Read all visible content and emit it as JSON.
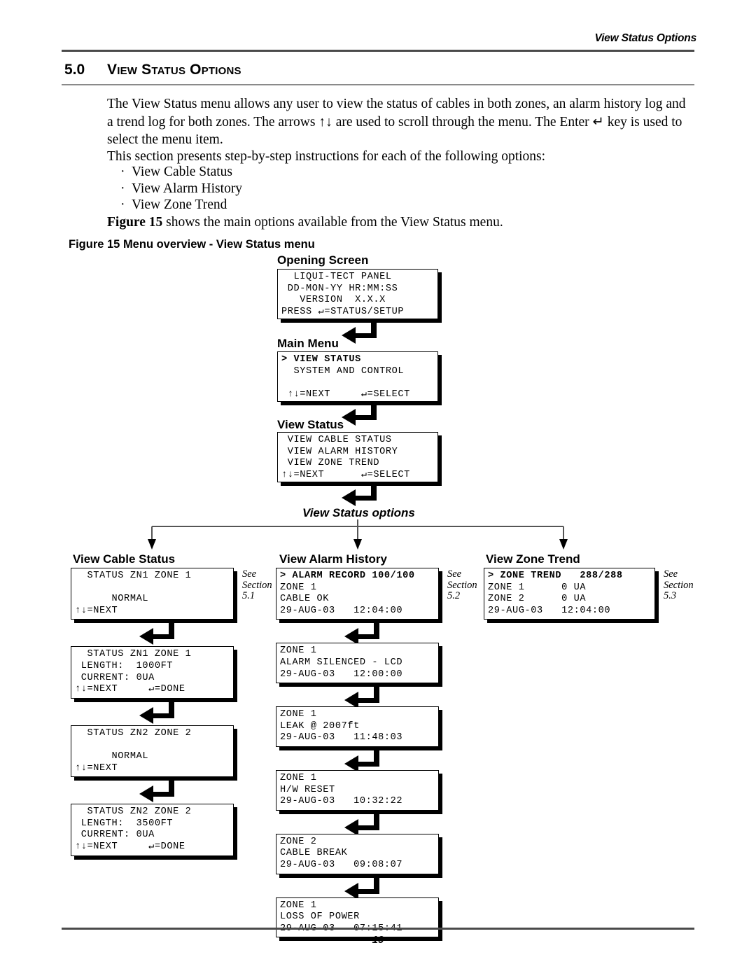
{
  "header": {
    "running_head": "View Status Options",
    "section_number": "5.0",
    "section_title": "View Status Options"
  },
  "body": {
    "paragraph_1": "The View Status menu allows any user to view the status of cables in both zones, an alarm history log and a trend log for both zones. The arrows ↑↓ are used to scroll through the menu. The Enter ↵ key is used to select the menu item.",
    "paragraph_2": "This section presents step-by-step instructions for each of the following options:",
    "bullets": [
      "View Cable Status",
      "View Alarm History",
      "View Zone Trend"
    ],
    "paragraph_3_bold": "Figure 15",
    "paragraph_3_rest": " shows the main options available from the View Status menu.",
    "figure_caption": "Figure 15  Menu overview - View Status menu"
  },
  "diagram": {
    "labels": {
      "opening_screen": "Opening Screen",
      "main_menu": "Main Menu",
      "view_status": "View Status",
      "view_status_options": "View Status options",
      "view_cable_status": "View Cable Status",
      "view_alarm_history": "View Alarm History",
      "view_zone_trend": "View Zone Trend"
    },
    "opening_screen": {
      "rows": [
        "  LIQUI-TECT PANEL",
        " DD-MON-YY HR:MM:SS",
        "   VERSION  X.X.X",
        "PRESS ↵=STATUS/SETUP"
      ]
    },
    "main_menu": {
      "rows": [
        "> VIEW STATUS",
        "  SYSTEM AND CONTROL",
        "",
        " ↑↓=NEXT     ↵=SELECT"
      ],
      "bold_rows": [
        0
      ]
    },
    "view_status": {
      "rows": [
        " VIEW CABLE STATUS",
        " VIEW ALARM HISTORY",
        " VIEW ZONE TREND",
        "↑↓=NEXT      ↵=SELECT"
      ]
    },
    "cable_status_screens": [
      {
        "rows": [
          "  STATUS ZN1 ZONE 1",
          "",
          "      NORMAL",
          "↑↓=NEXT"
        ],
        "note": "See\nSection\n5.1"
      },
      {
        "rows": [
          "  STATUS ZN1 ZONE 1",
          " LENGTH:  1000FT",
          " CURRENT: 0UA",
          "↑↓=NEXT     ↵=DONE"
        ],
        "note": ""
      },
      {
        "rows": [
          "  STATUS ZN2 ZONE 2",
          "",
          "      NORMAL",
          "↑↓=NEXT"
        ],
        "note": ""
      },
      {
        "rows": [
          "  STATUS ZN2 ZONE 2",
          " LENGTH:  3500FT",
          " CURRENT: 0UA",
          "↑↓=NEXT     ↵=DONE"
        ],
        "note": ""
      }
    ],
    "alarm_history_screens": [
      {
        "rows": [
          "> ALARM RECORD 100/100",
          "ZONE 1",
          "CABLE OK",
          "29-AUG-03   12:04:00"
        ],
        "bold_rows": [
          0
        ],
        "note": "See\nSection\n5.2"
      },
      {
        "rows": [
          "ZONE 1",
          "ALARM SILENCED - LCD",
          "29-AUG-03   12:00:00"
        ],
        "note": ""
      },
      {
        "rows": [
          "ZONE 1",
          "LEAK @ 2007ft",
          "29-AUG-03   11:48:03"
        ],
        "note": ""
      },
      {
        "rows": [
          "ZONE 1",
          "H/W RESET",
          "29-AUG-03   10:32:22"
        ],
        "note": ""
      },
      {
        "rows": [
          "ZONE 2",
          "CABLE BREAK",
          "29-AUG-03   09:08:07"
        ],
        "note": ""
      },
      {
        "rows": [
          "ZONE 1",
          "LOSS OF POWER",
          "29-AUG-03   07:15:41"
        ],
        "note": ""
      }
    ],
    "zone_trend_screens": [
      {
        "rows": [
          "> ZONE TREND   288/288",
          "ZONE 1      0 UA",
          "ZONE 2      0 UA",
          "29-AUG-03   12:04:00"
        ],
        "bold_rows": [
          0
        ],
        "note": "See\nSection\n5.3"
      }
    ]
  },
  "footer": {
    "page_number": "19"
  }
}
